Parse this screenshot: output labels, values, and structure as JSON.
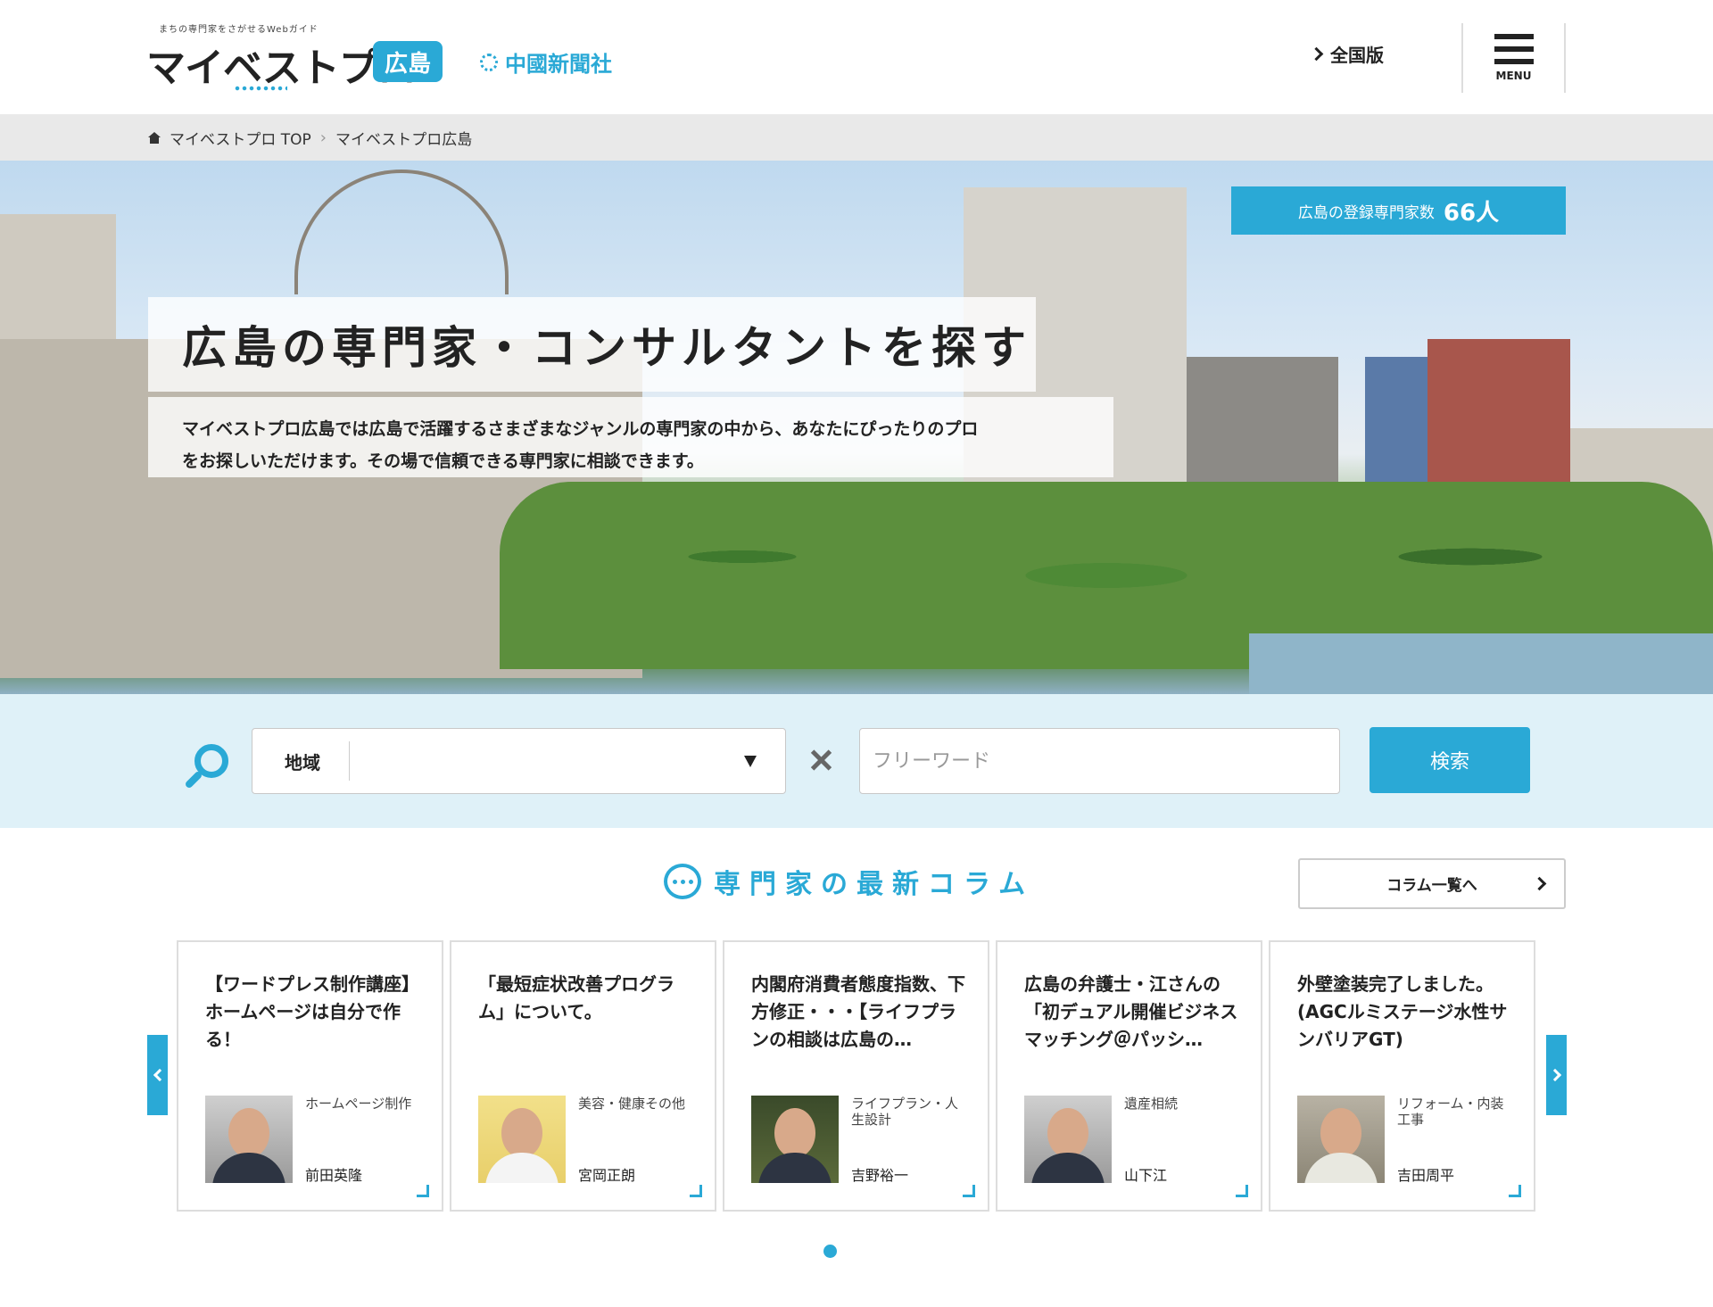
{
  "header": {
    "logo_tagline": "まちの専門家をさがせるWebガイド",
    "logo_text": "マイベストプロ",
    "logo_region_badge": "広島",
    "partner_logo_text": "中國新聞社",
    "national_link_label": "全国版",
    "menu_label": "MENU"
  },
  "breadcrumb": {
    "items": [
      "マイベストプロ TOP",
      "マイベストプロ広島"
    ]
  },
  "hero": {
    "count_label": "広島の登録専門家数",
    "count_value": "66人",
    "title": "広島の専門家・コンサルタントを探す",
    "description_line1": "マイベストプロ広島では広島で活躍するさまざまなジャンルの専門家の中から、あなたにぴったりのプロ",
    "description_line2": "をお探しいただけます。その場で信頼できる専門家に相談できます。"
  },
  "search": {
    "region_label": "地域",
    "region_value": "",
    "freeword_placeholder": "フリーワード",
    "button_label": "検索"
  },
  "columns": {
    "section_title": "専門家の最新コラム",
    "list_button_label": "コラム一覧へ",
    "cards": [
      {
        "title": "【ワードプレス制作講座】ホームページは自分で作る！",
        "genre": "ホームページ制作",
        "name": "前田英隆"
      },
      {
        "title": "「最短症状改善プログラム」について。",
        "genre": "美容・健康その他",
        "name": "宮岡正朗"
      },
      {
        "title": "内閣府消費者態度指数、下方修正・・・【ライフプランの相談は広島の…",
        "genre": "ライフプラン・人生設計",
        "name": "吉野裕一"
      },
      {
        "title": "広島の弁護士・江さんの「初デュアル開催ビジネスマッチング＠パッシ…",
        "genre": "遺産相続",
        "name": "山下江"
      },
      {
        "title": "外壁塗装完了しました。(AGCルミステージ水性サンバリアGT)",
        "genre": "リフォーム・内装工事",
        "name": "吉田周平"
      }
    ]
  },
  "colors": {
    "accent": "#2aa9d6",
    "search_band": "#dff1f8",
    "breadcrumb_bg": "#e9e9e9"
  }
}
